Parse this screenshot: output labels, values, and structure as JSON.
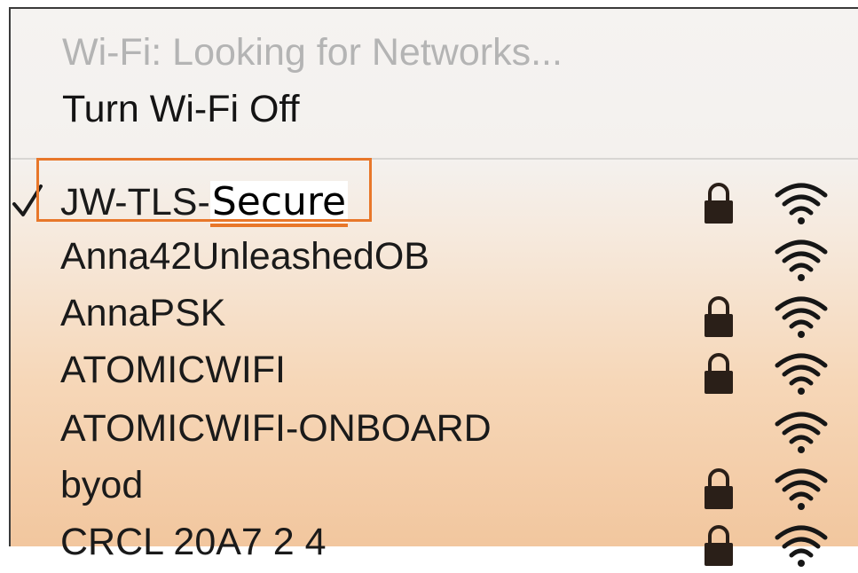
{
  "menu": {
    "status": "Wi-Fi: Looking for Networks...",
    "toggle_label": "Turn Wi-Fi Off"
  },
  "networks": [
    {
      "name_prefix": "JW-TLS-",
      "name_suffix": "Secure",
      "selected": true,
      "secured": true
    },
    {
      "name": "Anna42UnleashedOB",
      "selected": false,
      "secured": false
    },
    {
      "name": "AnnaPSK",
      "selected": false,
      "secured": true
    },
    {
      "name": "ATOMICWIFI",
      "selected": false,
      "secured": true
    },
    {
      "name": "ATOMICWIFI-ONBOARD",
      "selected": false,
      "secured": false
    },
    {
      "name": "byod",
      "selected": false,
      "secured": true
    },
    {
      "name": "CRCL 20A7 2 4",
      "selected": false,
      "secured": true
    }
  ],
  "colors": {
    "highlight": "#e8772a",
    "lock": "#2a1f18",
    "wifi": "#161616",
    "status_text": "#b4b4b4"
  },
  "icons": {
    "selected": "checkmark-icon",
    "secured": "lock-icon",
    "signal": "wifi-signal-icon"
  }
}
